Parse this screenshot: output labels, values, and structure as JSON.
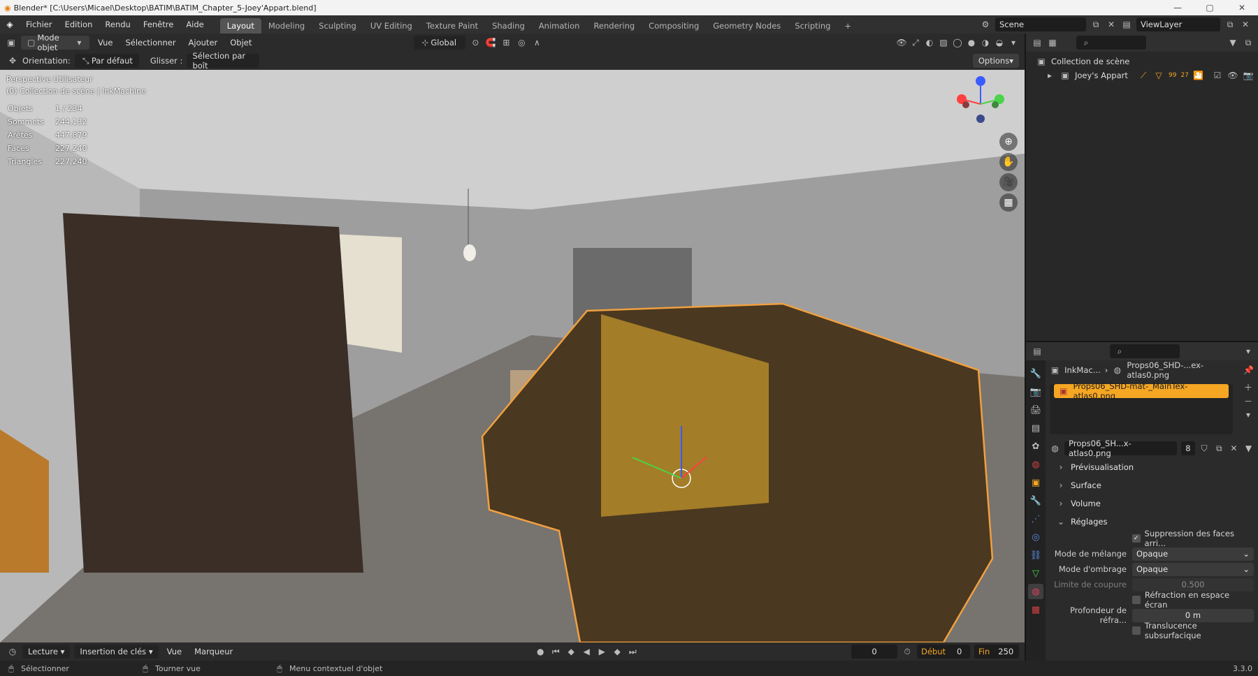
{
  "window": {
    "title": "Blender* [C:\\Users\\Micael\\Desktop\\BATIM\\BATIM_Chapter_5-Joey'Appart.blend]"
  },
  "menubar": {
    "items": [
      "Fichier",
      "Edition",
      "Rendu",
      "Fenêtre",
      "Aide"
    ],
    "workspaces": [
      "Layout",
      "Modeling",
      "Sculpting",
      "UV Editing",
      "Texture Paint",
      "Shading",
      "Animation",
      "Rendering",
      "Compositing",
      "Geometry Nodes",
      "Scripting"
    ],
    "active_workspace": "Layout",
    "scene": "Scene",
    "view_layer": "ViewLayer"
  },
  "viewport_header": {
    "mode": "Mode objet",
    "menus": [
      "Vue",
      "Sélectionner",
      "Ajouter",
      "Objet"
    ],
    "transform": "Global"
  },
  "tool_header": {
    "orientation_label": "Orientation:",
    "orientation_value": "Par défaut",
    "drag_label": "Glisser :",
    "drag_value": "Sélection par boît",
    "options": "Options"
  },
  "viewport": {
    "view_name": "Perspective Utilisateur",
    "collection_line": "(0) Collection de scène | InkMachine",
    "stats": [
      {
        "label": "Objets",
        "value": "1 / 234"
      },
      {
        "label": "Sommets",
        "value": "244,132"
      },
      {
        "label": "Arêtes",
        "value": "447,879"
      },
      {
        "label": "Faces",
        "value": "227,240"
      },
      {
        "label": "Triangles",
        "value": "227,240"
      }
    ]
  },
  "timeline": {
    "menus": [
      "Lecture",
      "Insertion de clés",
      "Vue",
      "Marqueur"
    ],
    "current_frame": "0",
    "start_label": "Début",
    "start": "0",
    "end_label": "Fin",
    "end": "250"
  },
  "statusbar": {
    "select": "Sélectionner",
    "rotate": "Tourner vue",
    "context": "Menu contextuel d'objet",
    "version": "3.3.0"
  },
  "outliner": {
    "root": "Collection de scène",
    "child": "Joey's Appart",
    "badge": "99",
    "badge2": "27"
  },
  "properties": {
    "breadcrumb_object": "InkMac...",
    "breadcrumb_material": "Props06_SHD-...ex-atlas0.png",
    "slot_name": "Props06_SHD-mat-_MainTex-atlas0.png",
    "material_name": "Props06_SH...x-atlas0.png",
    "users": "8",
    "panels": [
      "Prévisualisation",
      "Surface",
      "Volume",
      "Réglages"
    ],
    "backface": "Suppression des faces arri...",
    "blend_label": "Mode de mélange",
    "blend_value": "Opaque",
    "shadow_label": "Mode d'ombrage",
    "shadow_value": "Opaque",
    "clip_label": "Limite de coupure",
    "clip_value": "0.500",
    "refraction": "Réfraction en espace écran",
    "refr_depth_label": "Profondeur de réfra...",
    "refr_depth_value": "0 m",
    "subsurface": "Translucence subsurfacique"
  },
  "colors": {
    "accent": "#f5a623",
    "selected_outline": "#f0a040",
    "active_tab": "#545454"
  }
}
